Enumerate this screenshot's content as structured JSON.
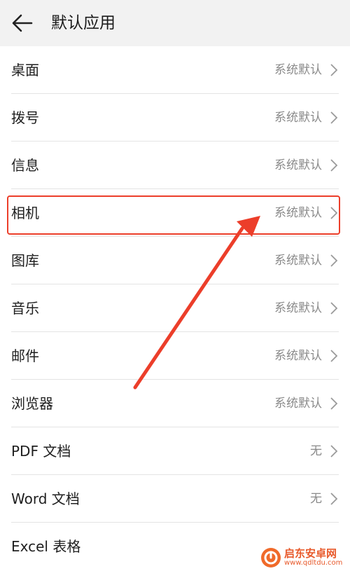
{
  "header": {
    "title": "默认应用",
    "back_icon": "arrow-left-icon"
  },
  "rows": [
    {
      "label": "桌面",
      "value": "系统默认"
    },
    {
      "label": "拨号",
      "value": "系统默认"
    },
    {
      "label": "信息",
      "value": "系统默认"
    },
    {
      "label": "相机",
      "value": "系统默认"
    },
    {
      "label": "图库",
      "value": "系统默认"
    },
    {
      "label": "音乐",
      "value": "系统默认"
    },
    {
      "label": "邮件",
      "value": "系统默认"
    },
    {
      "label": "浏览器",
      "value": "系统默认"
    },
    {
      "label": "PDF 文档",
      "value": "无"
    },
    {
      "label": "Word 文档",
      "value": "无"
    },
    {
      "label": "Excel 表格",
      "value": ""
    }
  ],
  "highlighted_row": "相机",
  "colors": {
    "highlight": "#ec3e2a",
    "background": "#f2f2f2",
    "row_background": "#ffffff",
    "value_text": "#8a8a8a"
  },
  "watermark": {
    "name": "启东安卓网",
    "url": "www.qdltdu.com"
  }
}
